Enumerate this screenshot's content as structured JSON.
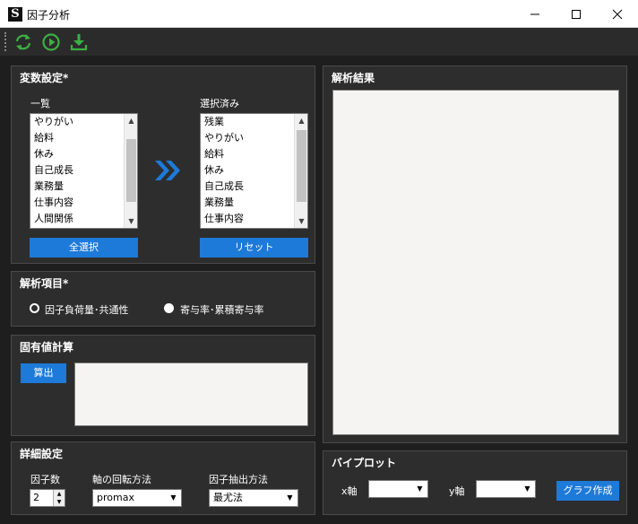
{
  "window": {
    "title": "因子分析",
    "app_icon_letter": "S"
  },
  "toolbar": {
    "refresh_icon": "refresh-icon",
    "run_icon": "play-circle-icon",
    "download_icon": "download-icon",
    "accent": "#3cb043"
  },
  "variables": {
    "title": "変数設定*",
    "list_label": "一覧",
    "list_items": [
      "やりがい",
      "給料",
      "休み",
      "自己成長",
      "業務量",
      "仕事内容",
      "人間関係"
    ],
    "selected_label": "選択済み",
    "selected_items": [
      "残業",
      "やりがい",
      "給料",
      "休み",
      "自己成長",
      "業務量",
      "仕事内容"
    ],
    "select_all": "全選択",
    "reset": "リセット"
  },
  "analysis_items": {
    "title": "解析項目*",
    "option1": "因子負荷量･共通性",
    "option2": "寄与率･累積寄与率"
  },
  "eigen": {
    "title": "固有値計算",
    "calc_button": "算出"
  },
  "detail": {
    "title": "詳細設定",
    "factor_count_label": "因子数",
    "factor_count": "2",
    "rotation_label": "軸の回転方法",
    "rotation_value": "promax",
    "extraction_label": "因子抽出方法",
    "extraction_value": "最尤法"
  },
  "results": {
    "title": "解析結果"
  },
  "biplot": {
    "title": "バイプロット",
    "x_label": "x軸",
    "y_label": "y軸",
    "button": "グラフ作成"
  }
}
